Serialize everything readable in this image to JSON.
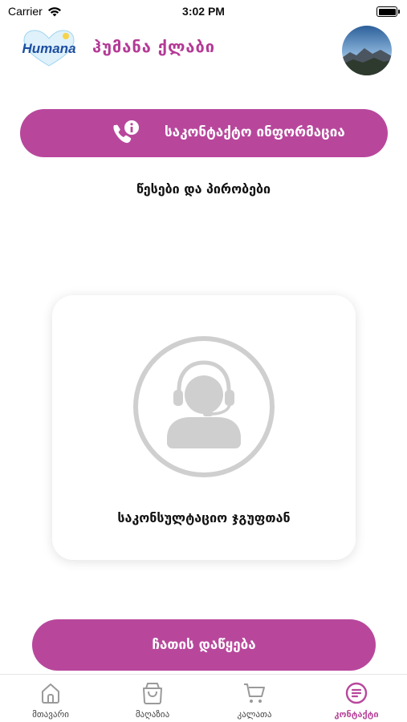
{
  "status_bar": {
    "carrier": "Carrier",
    "time": "3:02 PM"
  },
  "header": {
    "logo_text": "Humana",
    "title": "ჰუმანა ქლაბი"
  },
  "main": {
    "contact_info_label": "საკონტაქტო ინფორმაცია",
    "terms_label": "წესები და პირობები",
    "consultation_label": "საკონსულტაციო ჯგუფთან",
    "start_chat_label": "ჩათის დაწყება"
  },
  "tabbar": {
    "tabs": [
      {
        "label": "მთავარი",
        "icon": "home-icon",
        "active": false
      },
      {
        "label": "მაღაზია",
        "icon": "bag-icon",
        "active": false
      },
      {
        "label": "კალათა",
        "icon": "cart-icon",
        "active": false
      },
      {
        "label": "კონტაქტი",
        "icon": "contact-list-icon",
        "active": true
      }
    ]
  },
  "colors": {
    "accent": "#b8479c",
    "title": "#b43a96",
    "icon_gray": "#cfcfcf",
    "inactive_tab": "#9a9a9a"
  }
}
